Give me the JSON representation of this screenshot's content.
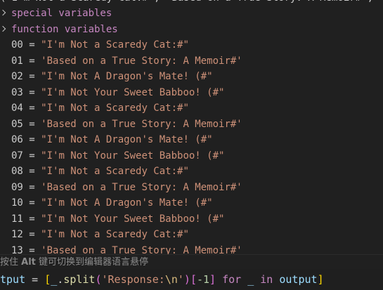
{
  "hover": {
    "cut_line": "( I'm Not a Scaredy Cat:#\", 'Based on a True Story: A Memoir#', \"I'm No",
    "groups": [
      {
        "label": "special variables"
      },
      {
        "label": "function variables"
      }
    ],
    "items": [
      {
        "index": "00",
        "value": "\"I'm Not a Scaredy Cat:#\""
      },
      {
        "index": "01",
        "value": "'Based on a True Story: A Memoir#'"
      },
      {
        "index": "02",
        "value": "\"I'm Not A Dragon's Mate! (#\""
      },
      {
        "index": "03",
        "value": "\"I'm Not Your Sweet Babboo! (#\""
      },
      {
        "index": "04",
        "value": "\"I'm Not a Scaredy Cat:#\""
      },
      {
        "index": "05",
        "value": "'Based on a True Story: A Memoir#'"
      },
      {
        "index": "06",
        "value": "\"I'm Not A Dragon's Mate! (#\""
      },
      {
        "index": "07",
        "value": "\"I'm Not Your Sweet Babboo! (#\""
      },
      {
        "index": "08",
        "value": "\"I'm Not a Scaredy Cat:#\""
      },
      {
        "index": "09",
        "value": "'Based on a True Story: A Memoir#'"
      },
      {
        "index": "10",
        "value": "\"I'm Not A Dragon's Mate! (#\""
      },
      {
        "index": "11",
        "value": "\"I'm Not Your Sweet Babboo! (#\""
      },
      {
        "index": "12",
        "value": "\"I'm Not a Scaredy Cat:#\""
      },
      {
        "index": "13",
        "value": "'Based on a True Story: A Memoir#'"
      }
    ],
    "hint_prefix": "按住 ",
    "hint_key": "Alt",
    "hint_suffix": " 键可切换到编辑器语言悬停"
  },
  "editor": {
    "tokens": {
      "var1": "tput",
      "eq": " = ",
      "lbr": "[",
      "obj": "_",
      "dot": ".",
      "fn": "split",
      "lp": "(",
      "str1": "'Response:",
      "esc": "\\n",
      "str2": "'",
      "rp": ")",
      "lbr2": "[",
      "num": "-1",
      "rbr2": "]",
      "sp1": " ",
      "kw1": "for",
      "sp2": " ",
      "it": "_",
      "sp3": " ",
      "kw2": "in",
      "sp4": " ",
      "var2": "output",
      "rbr": "]"
    }
  },
  "colors": {
    "background": "#1f1f1f",
    "string": "#ce9178",
    "keyword": "#c586c0",
    "variable": "#9cdcfe",
    "function": "#dcdcaa",
    "bracket": "#ffd700"
  }
}
